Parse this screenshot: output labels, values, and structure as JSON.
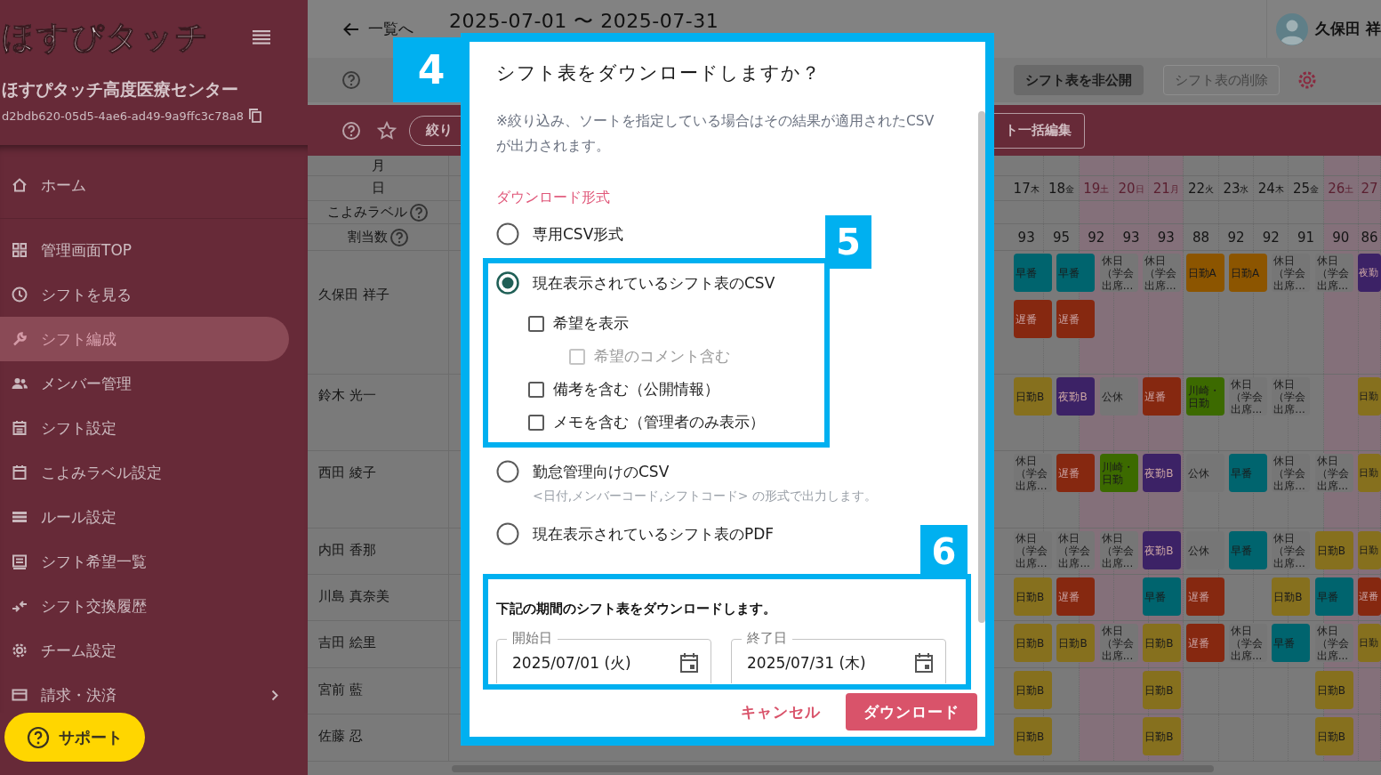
{
  "sidebar": {
    "logo": "ほすぴタッチ",
    "organization": "ほすぴタッチ高度医療センター",
    "org_id": "d2bdb620-05d5-4ae6-ad49-9a9ffc3c78a8",
    "items": [
      {
        "label": "ホーム",
        "selected": false,
        "kind": "link"
      },
      {
        "label": "管理画面TOP",
        "selected": false,
        "kind": "link"
      },
      {
        "label": "シフトを見る",
        "selected": false,
        "kind": "link"
      },
      {
        "label": "シフト編成",
        "selected": true,
        "kind": "link"
      },
      {
        "label": "メンバー管理",
        "selected": false,
        "kind": "link"
      },
      {
        "label": "シフト設定",
        "selected": false,
        "kind": "link"
      },
      {
        "label": "こよみラベル設定",
        "selected": false,
        "kind": "link"
      },
      {
        "label": "ルール設定",
        "selected": false,
        "kind": "link"
      },
      {
        "label": "シフト希望一覧",
        "selected": false,
        "kind": "link"
      },
      {
        "label": "シフト交換履歴",
        "selected": false,
        "kind": "link"
      },
      {
        "label": "チーム設定",
        "selected": false,
        "kind": "link"
      },
      {
        "label": "請求・決済",
        "selected": false,
        "kind": "submenu"
      }
    ]
  },
  "support_button": "サポート",
  "topbar": {
    "back_link": "一覧へ",
    "period": "2025-07-01 〜 2025-07-31",
    "user_name": "久保田 祥"
  },
  "toolbar": {
    "buttons": [
      {
        "label": "シフト表を非公開",
        "disabled": false
      },
      {
        "label": "シフト表の削除",
        "disabled": true
      }
    ]
  },
  "filter_bar": {
    "filter_button": "絞り",
    "bulk_edit_button": "ト一括編集"
  },
  "grid": {
    "header_rows": [
      {
        "label": "月",
        "help": false
      },
      {
        "label": "日",
        "help": false
      },
      {
        "label": "こよみラベル",
        "help": true
      },
      {
        "label": "割当数",
        "help": true
      }
    ],
    "days": [
      {
        "day": "17",
        "weekday": "木",
        "count": "93",
        "holiday": false
      },
      {
        "day": "18",
        "weekday": "金",
        "count": "95",
        "holiday": false
      },
      {
        "day": "19",
        "weekday": "土",
        "count": "92",
        "holiday": true
      },
      {
        "day": "20",
        "weekday": "日",
        "count": "93",
        "holiday": true
      },
      {
        "day": "21",
        "weekday": "月",
        "count": "93",
        "holiday": true
      },
      {
        "day": "22",
        "weekday": "火",
        "count": "88",
        "holiday": false
      },
      {
        "day": "23",
        "weekday": "水",
        "count": "92",
        "holiday": false
      },
      {
        "day": "24",
        "weekday": "木",
        "count": "92",
        "holiday": false
      },
      {
        "day": "25",
        "weekday": "金",
        "count": "91",
        "holiday": false
      },
      {
        "day": "26",
        "weekday": "土",
        "count": "90",
        "holiday": true
      },
      {
        "day": "27",
        "count": "86",
        "holiday": true
      }
    ],
    "members": [
      {
        "name": "久保田 祥子",
        "lines": [
          [
            {
              "kind": "shift",
              "label": "早番",
              "color": "#00646e"
            },
            {
              "kind": "shift",
              "label": "早番",
              "color": "#00646e"
            },
            {
              "kind": "shift",
              "label": "休日（学会出席...",
              "color": "#767676"
            },
            {
              "kind": "shift",
              "label": "休日（学会出席...",
              "color": "#767676"
            },
            {
              "kind": "shift",
              "label": "日勤A",
              "color": "#8c5500"
            },
            {
              "kind": "shift",
              "label": "日勤A",
              "color": "#8c5500"
            },
            {
              "kind": "shift",
              "label": "休日（学会出席...",
              "color": "#767676"
            },
            {
              "kind": "shift",
              "label": "休日（学会出席...",
              "color": "#767676"
            },
            {
              "kind": "shift",
              "label": "夜勤",
              "color": "#3c2266"
            }
          ],
          [
            {
              "kind": "shift",
              "label": "遅番",
              "color": "#862810"
            },
            {
              "kind": "shift",
              "label": "遅番",
              "color": "#862810"
            }
          ]
        ]
      },
      {
        "name": "鈴木 光一",
        "lines": [
          [
            {
              "kind": "shift",
              "label": "日勤B",
              "color": "#86701e"
            },
            {
              "kind": "shift",
              "label": "夜勤B",
              "color": "#3c2266"
            },
            {
              "kind": "shift",
              "label": "公休",
              "color": "#767676"
            },
            {
              "kind": "shift",
              "label": "遅番",
              "color": "#862810"
            },
            {
              "kind": "shift",
              "label": "川崎・日勤",
              "color": "#3c6a00"
            },
            {
              "kind": "shift",
              "label": "休日（学会出席...",
              "color": "#767676"
            },
            {
              "kind": "shift",
              "label": "休日（学会出席...",
              "color": "#767676"
            },
            {
              "kind": "empty"
            },
            {
              "kind": "shift",
              "label": "日勤",
              "color": "#86701e"
            }
          ]
        ]
      },
      {
        "name": "西田 綾子",
        "lines": [
          [
            {
              "kind": "shift",
              "label": "休日（学会出席...",
              "color": "#767676"
            },
            {
              "kind": "shift",
              "label": "遅番",
              "color": "#862810"
            },
            {
              "kind": "shift",
              "label": "川崎・日勤",
              "color": "#3c6a00"
            },
            {
              "kind": "shift",
              "label": "夜勤B",
              "color": "#3c2266"
            },
            {
              "kind": "shift",
              "label": "公休",
              "color": "#767676"
            },
            {
              "kind": "shift",
              "label": "早番",
              "color": "#00646e"
            },
            {
              "kind": "shift",
              "label": "休日（学会出席...",
              "color": "#767676"
            },
            {
              "kind": "shift",
              "label": "休日（学会出席...",
              "color": "#767676"
            },
            {
              "kind": "shift",
              "label": "日勤",
              "color": "#86701e"
            }
          ]
        ]
      },
      {
        "name": "内田 香那",
        "lines": [
          [
            {
              "kind": "shift",
              "label": "休日（学会出席...",
              "color": "#767676"
            },
            {
              "kind": "shift",
              "label": "休日（学会出席...",
              "color": "#767676"
            },
            {
              "kind": "shift",
              "label": "休日（学会出席...",
              "color": "#767676"
            },
            {
              "kind": "shift",
              "label": "夜勤B",
              "color": "#3c2266"
            },
            {
              "kind": "shift",
              "label": "公休",
              "color": "#767676"
            },
            {
              "kind": "shift",
              "label": "早番",
              "color": "#00646e"
            },
            {
              "kind": "shift",
              "label": "休日（学会出席...",
              "color": "#767676"
            },
            {
              "kind": "shift",
              "label": "日勤B",
              "color": "#86701e"
            },
            {
              "kind": "shift",
              "label": "日勤",
              "color": "#86701e"
            }
          ]
        ]
      },
      {
        "name": "川島 真奈美",
        "lines": [
          [
            {
              "kind": "shift",
              "label": "日勤B",
              "color": "#86701e"
            },
            {
              "kind": "shift",
              "label": "遅番",
              "color": "#862810"
            },
            {
              "kind": "empty"
            },
            {
              "kind": "shift",
              "label": "早番",
              "color": "#00646e"
            },
            {
              "kind": "shift",
              "label": "遅番",
              "color": "#862810"
            },
            {
              "kind": "empty"
            },
            {
              "kind": "shift",
              "label": "日勤B",
              "color": "#86701e"
            },
            {
              "kind": "shift",
              "label": "早番",
              "color": "#00646e"
            },
            {
              "kind": "shift",
              "label": "遅番",
              "color": "#862810"
            }
          ]
        ]
      },
      {
        "name": "吉田 絵里",
        "lines": [
          [
            {
              "kind": "shift",
              "label": "日勤B",
              "color": "#86701e"
            },
            {
              "kind": "shift",
              "label": "日勤B",
              "color": "#86701e"
            },
            {
              "kind": "shift",
              "label": "休日（学会出席...",
              "color": "#767676"
            },
            {
              "kind": "shift",
              "label": "日勤B",
              "color": "#86701e"
            },
            {
              "kind": "shift",
              "label": "遅番",
              "color": "#862810"
            },
            {
              "kind": "shift",
              "label": "休日（学会出席...",
              "color": "#767676"
            },
            {
              "kind": "shift",
              "label": "早番",
              "color": "#00646e"
            },
            {
              "kind": "shift",
              "label": "休日（学会出席...",
              "color": "#767676"
            },
            {
              "kind": "shift",
              "label": "日勤",
              "color": "#86701e"
            }
          ]
        ]
      },
      {
        "name": "宮前 藍",
        "lines": [
          [
            {
              "kind": "shift",
              "label": "日勤B",
              "color": "#86701e"
            },
            {
              "kind": "empty"
            },
            {
              "kind": "empty"
            },
            {
              "kind": "shift",
              "label": "日勤B",
              "color": "#86701e"
            },
            {
              "kind": "empty"
            },
            {
              "kind": "empty"
            },
            {
              "kind": "empty"
            },
            {
              "kind": "shift",
              "label": "日勤B",
              "color": "#86701e"
            }
          ]
        ]
      },
      {
        "name": "佐藤 忍",
        "lines": [
          [
            {
              "kind": "shift",
              "label": "日勤B",
              "color": "#86701e"
            },
            {
              "kind": "empty"
            },
            {
              "kind": "empty"
            },
            {
              "kind": "shift",
              "label": "日勤B",
              "color": "#86701e"
            },
            {
              "kind": "empty"
            },
            {
              "kind": "empty"
            },
            {
              "kind": "empty"
            },
            {
              "kind": "shift",
              "label": "日勤B",
              "color": "#86701e"
            }
          ]
        ]
      }
    ]
  },
  "dialog": {
    "title": "シフト表をダウンロードしますか？",
    "note": "※絞り込み、ソートを指定している場合はその結果が適用されたCSVが出力されます。",
    "section_label": "ダウンロード形式",
    "options": [
      {
        "label": "専用CSV形式",
        "selected": false
      },
      {
        "label": "現在表示されているシフト表のCSV",
        "selected": true,
        "suboptions": [
          {
            "label": "希望を表示",
            "checked": false,
            "disabled": false,
            "children": [
              {
                "label": "希望のコメント含む",
                "checked": false,
                "disabled": true
              }
            ]
          },
          {
            "label": "備考を含む（公開情報）",
            "checked": false,
            "disabled": false
          },
          {
            "label": "メモを含む（管理者のみ表示）",
            "checked": false,
            "disabled": false
          }
        ]
      },
      {
        "label": "勤怠管理向けのCSV",
        "selected": false,
        "description": "<日付,メンバーコード,シフトコード> の形式で出力します。"
      },
      {
        "label": "現在表示されているシフト表のPDF",
        "selected": false
      }
    ],
    "period_caption": "下記の期間のシフト表をダウンロードします。",
    "fields": [
      {
        "label": "開始日",
        "value": "2025/07/01 (火)"
      },
      {
        "label": "終了日",
        "value": "2025/07/31 (木)"
      }
    ],
    "buttons": [
      {
        "label": "キャンセル",
        "kind": "text"
      },
      {
        "label": "ダウンロード",
        "kind": "primary"
      }
    ]
  },
  "callouts": [
    {
      "number": "4",
      "kind": "badge"
    },
    {
      "number": "5",
      "kind": "frame"
    },
    {
      "number": "6",
      "kind": "frame"
    }
  ]
}
